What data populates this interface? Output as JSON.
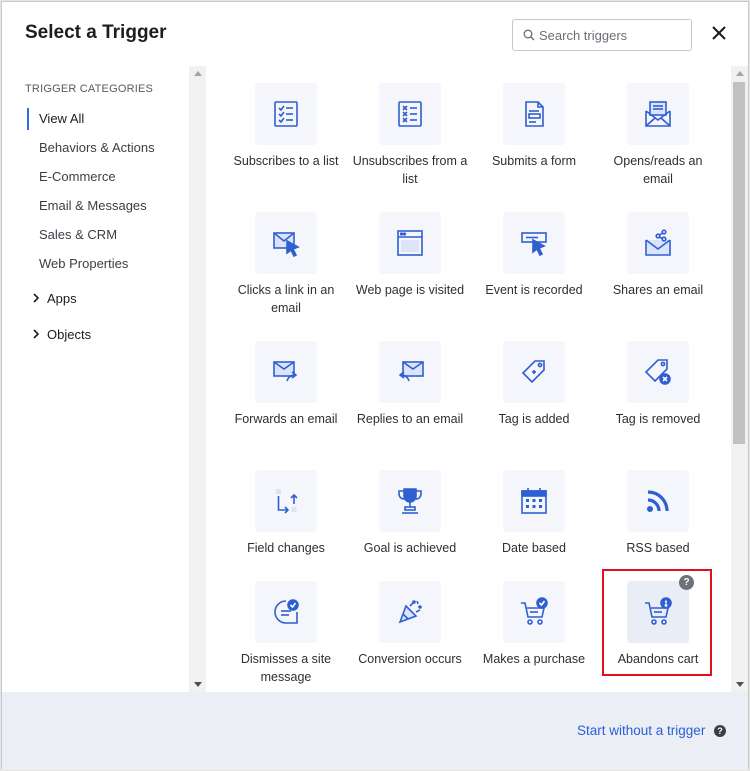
{
  "header": {
    "title": "Select a Trigger",
    "search_placeholder": "Search triggers",
    "close_icon": "close-icon"
  },
  "sidebar": {
    "heading": "TRIGGER CATEGORIES",
    "items": [
      {
        "label": "View All",
        "active": true
      },
      {
        "label": "Behaviors & Actions"
      },
      {
        "label": "E-Commerce"
      },
      {
        "label": "Email & Messages"
      },
      {
        "label": "Sales & CRM"
      },
      {
        "label": "Web Properties"
      }
    ],
    "groups": [
      {
        "label": "Apps",
        "icon": "chevron-right-icon"
      },
      {
        "label": "Objects",
        "icon": "chevron-right-icon"
      }
    ]
  },
  "triggers": [
    {
      "label": "Subscribes to a list",
      "icon": "list-check-icon"
    },
    {
      "label": "Unsubscribes from a list",
      "icon": "list-x-icon"
    },
    {
      "label": "Submits a form",
      "icon": "form-icon"
    },
    {
      "label": "Opens/reads an email",
      "icon": "open-envelope-icon"
    },
    {
      "label": "Clicks a link in an email",
      "icon": "envelope-cursor-icon"
    },
    {
      "label": "Web page is visited",
      "icon": "browser-window-icon"
    },
    {
      "label": "Event is recorded",
      "icon": "event-cursor-icon"
    },
    {
      "label": "Shares an email",
      "icon": "share-envelope-icon"
    },
    {
      "label": "Forwards an email",
      "icon": "forward-envelope-icon"
    },
    {
      "label": "Replies to an email",
      "icon": "reply-envelope-icon"
    },
    {
      "label": "Tag is added",
      "icon": "tag-add-icon"
    },
    {
      "label": "Tag is removed",
      "icon": "tag-remove-icon"
    },
    {
      "label": "Field changes",
      "icon": "field-change-icon"
    },
    {
      "label": "Goal is achieved",
      "icon": "trophy-icon"
    },
    {
      "label": "Date based",
      "icon": "calendar-icon"
    },
    {
      "label": "RSS based",
      "icon": "rss-icon"
    },
    {
      "label": "Dismisses a site message",
      "icon": "dismiss-message-icon"
    },
    {
      "label": "Conversion occurs",
      "icon": "party-popper-icon"
    },
    {
      "label": "Makes a purchase",
      "icon": "cart-check-icon"
    },
    {
      "label": "Abandons cart",
      "icon": "cart-alert-icon",
      "highlighted": true,
      "help_badge": "?"
    }
  ],
  "footer": {
    "link_label": "Start without a trigger",
    "help_badge": "?"
  },
  "colors": {
    "accent": "#356ae6",
    "icon_blue": "#2f5fd0",
    "highlight_border": "#e0111a",
    "footer_bg": "#ebeef5"
  }
}
